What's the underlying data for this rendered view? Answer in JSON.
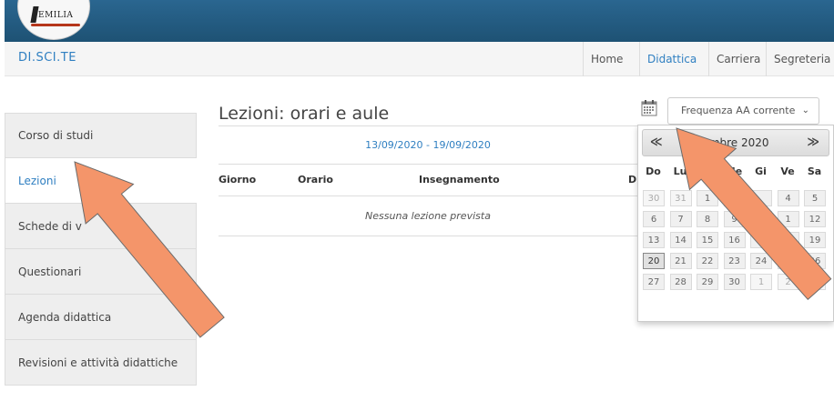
{
  "header": {
    "logo_text": "EMILIA"
  },
  "navbar": {
    "brand": "DI.SCI.TE",
    "items": [
      {
        "label": "Home"
      },
      {
        "label": "Didattica"
      },
      {
        "label": "Carriera"
      },
      {
        "label": "Segreteria"
      }
    ]
  },
  "sidebar": {
    "items": [
      {
        "label": "Corso di studi"
      },
      {
        "label": "Lezioni"
      },
      {
        "label": "Schede di v"
      },
      {
        "label": "Questionari"
      },
      {
        "label": "Agenda didattica"
      },
      {
        "label": "Revisioni e attività didattiche"
      }
    ]
  },
  "main": {
    "title": "Lezioni: orari e aule",
    "week_range": "13/09/2020 - 19/09/2020",
    "frequency_select": "Frequenza AA corrente",
    "table": {
      "columns": [
        "Giorno",
        "Orario",
        "Insegnamento",
        "D"
      ],
      "empty_message": "Nessuna lezione prevista"
    }
  },
  "datepicker": {
    "title": "embre 2020",
    "prev": "≪",
    "next": "≫",
    "weekdays": [
      "Do",
      "Lu",
      "",
      "Me",
      "Gi",
      "Ve",
      "Sa"
    ],
    "weeks": [
      [
        "30",
        "31",
        "1",
        "",
        "",
        "4",
        "5"
      ],
      [
        "6",
        "7",
        "8",
        "9",
        "",
        "1",
        "12"
      ],
      [
        "13",
        "14",
        "15",
        "16",
        "1",
        "",
        "19"
      ],
      [
        "20",
        "21",
        "22",
        "23",
        "24",
        "25",
        "26"
      ],
      [
        "27",
        "28",
        "29",
        "30",
        "1",
        "2",
        "3"
      ]
    ]
  },
  "annotations": {
    "arrow_color": "#f4956a",
    "arrow_stroke": "#6b6b6b"
  }
}
